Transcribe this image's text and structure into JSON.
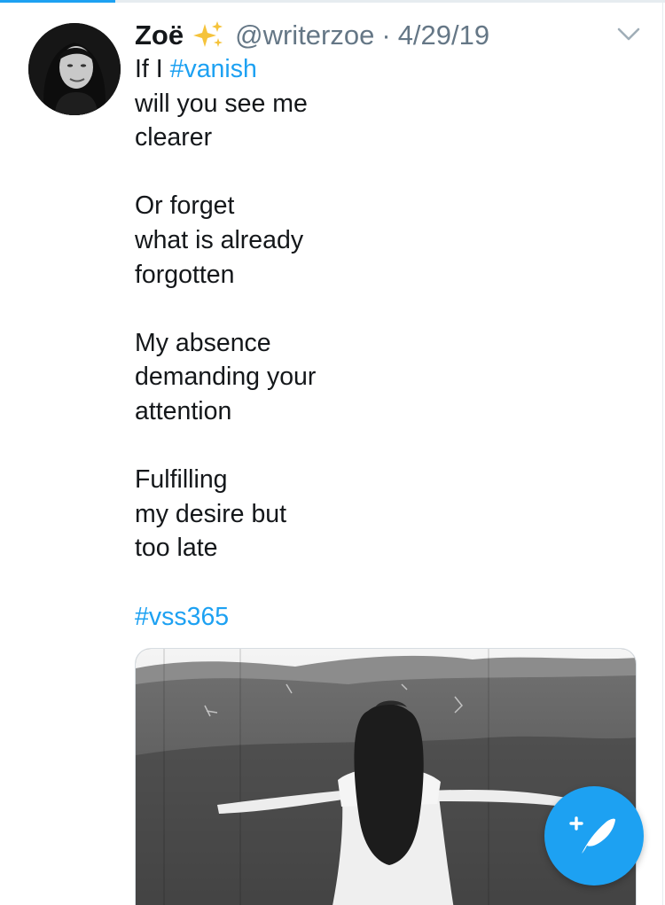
{
  "colors": {
    "accent": "#1da1f2",
    "text_primary": "#14171a",
    "text_secondary": "#657786"
  },
  "tab_bar": {
    "active_indicator_color": "#1da1f2"
  },
  "tweet": {
    "author": {
      "display_name": "Zoë",
      "emoji": "✨",
      "handle": "@writerzoe"
    },
    "separator": "·",
    "timestamp": "4/29/19",
    "menu_icon": "chevron-down-icon",
    "body": [
      [
        {
          "text": "If I "
        },
        {
          "text": "#vanish",
          "hashtag": true
        }
      ],
      [
        {
          "text": "will you see me"
        }
      ],
      [
        {
          "text": "clearer"
        }
      ],
      [],
      [
        {
          "text": "Or forget"
        }
      ],
      [
        {
          "text": "what is already"
        }
      ],
      [
        {
          "text": "forgotten"
        }
      ],
      [],
      [
        {
          "text": "My absence"
        }
      ],
      [
        {
          "text": "demanding your"
        }
      ],
      [
        {
          "text": "attention"
        }
      ],
      [],
      [
        {
          "text": "Fulfilling"
        }
      ],
      [
        {
          "text": "my desire but"
        }
      ],
      [
        {
          "text": "too late"
        }
      ],
      [],
      [
        {
          "text": "#vss365",
          "hashtag": true
        }
      ]
    ],
    "media": {
      "icon": "photo"
    }
  },
  "compose_button": {
    "icon": "compose-tweet-icon",
    "color": "#1da1f2"
  }
}
